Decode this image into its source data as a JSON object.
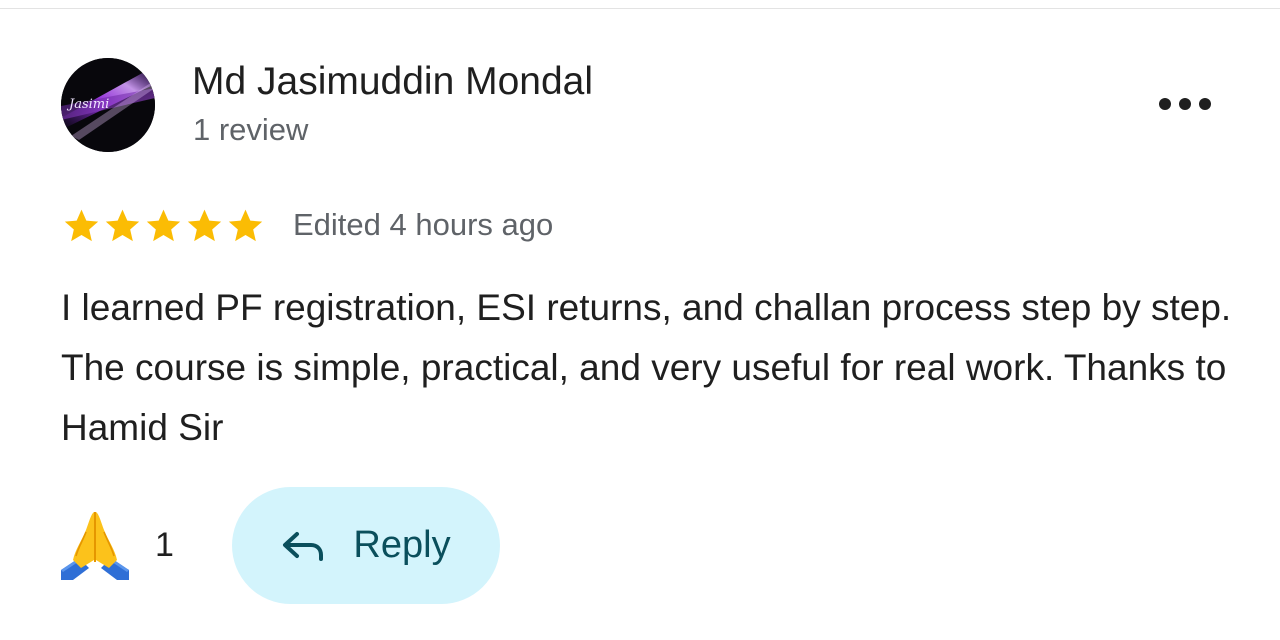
{
  "reviewer": {
    "name": "Md Jasimuddin Mondal",
    "review_count": "1 review",
    "avatar_text": "Jasimi"
  },
  "review": {
    "rating": 5,
    "rating_max": 5,
    "edited_time": "Edited 4 hours ago",
    "text": "I learned PF registration, ESI returns, and challan process step by step. The course is simple, practical, and very useful for real work. Thanks to Hamid Sir"
  },
  "reactions": {
    "icon": "folded-hands-emoji",
    "count": "1"
  },
  "actions": {
    "reply_label": "Reply",
    "reply_icon": "reply-arrow-icon",
    "more_icon": "more-options-icon"
  },
  "colors": {
    "star": "#fbbc04",
    "reply_bg": "#d3f4fc",
    "reply_text": "#0a4f5c",
    "secondary_text": "#5f6368"
  }
}
